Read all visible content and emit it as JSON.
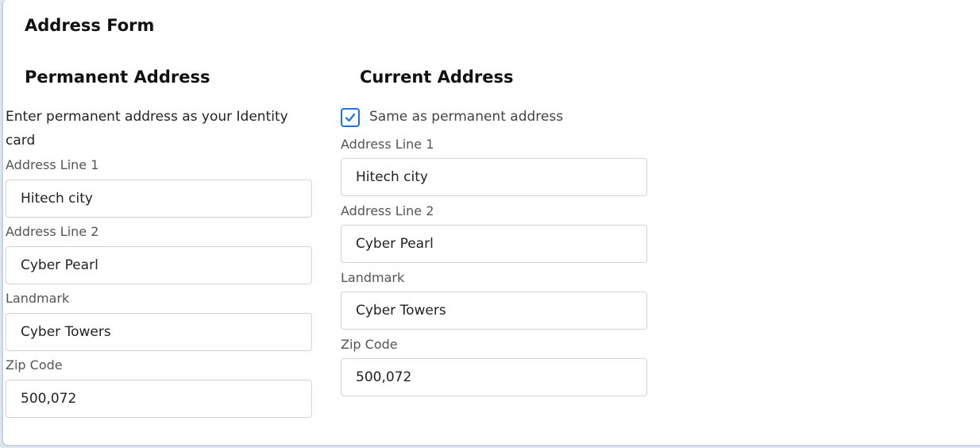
{
  "form": {
    "title": "Address Form"
  },
  "permanent": {
    "title": "Permanent Address",
    "description": "Enter permanent address as your Identity card",
    "address_line1": {
      "label": "Address Line 1",
      "value": "Hitech city"
    },
    "address_line2": {
      "label": "Address Line 2",
      "value": "Cyber Pearl"
    },
    "landmark": {
      "label": "Landmark",
      "value": "Cyber Towers"
    },
    "zip": {
      "label": "Zip Code",
      "value": "500,072"
    }
  },
  "current": {
    "title": "Current Address",
    "same_as_label": "Same as permanent address",
    "same_as_checked": true,
    "address_line1": {
      "label": "Address Line 1",
      "value": "Hitech city"
    },
    "address_line2": {
      "label": "Address Line 2",
      "value": "Cyber Pearl"
    },
    "landmark": {
      "label": "Landmark",
      "value": "Cyber Towers"
    },
    "zip": {
      "label": "Zip Code",
      "value": "500,072"
    }
  },
  "colors": {
    "accent": "#1a73e8",
    "input_border": "#ced4da",
    "label": "#555555"
  },
  "icons": {
    "checkbox": "checkmark-icon"
  }
}
